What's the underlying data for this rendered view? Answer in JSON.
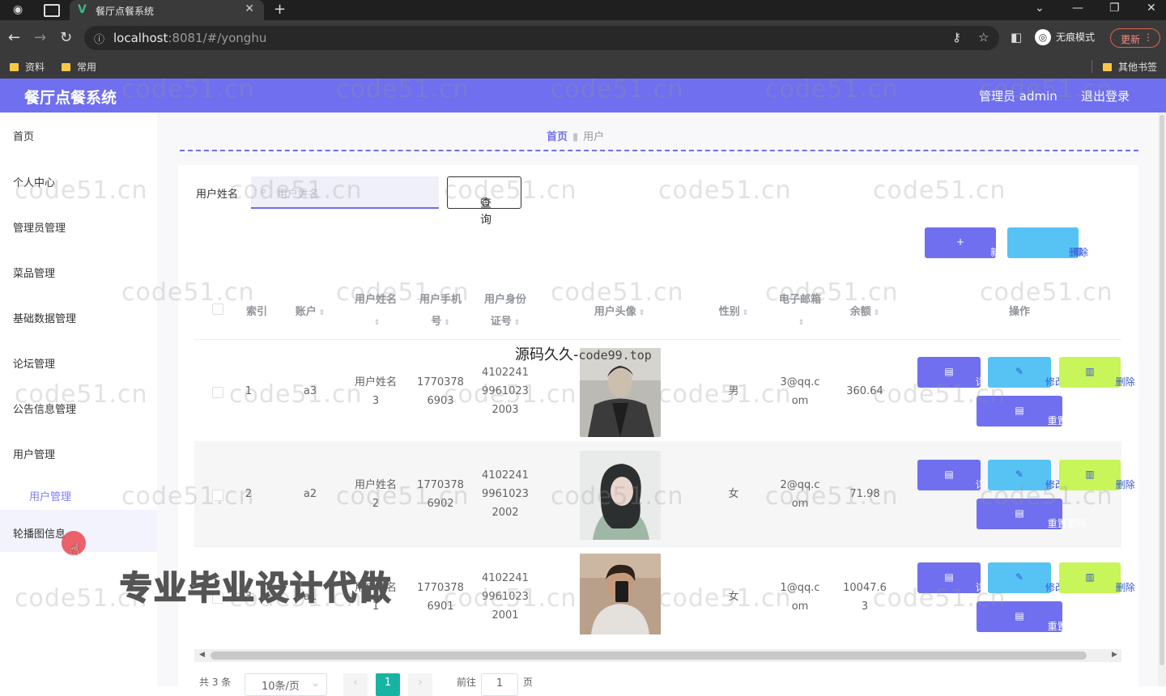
{
  "browser": {
    "tab_title": "餐厅点餐系统",
    "url_host": "localhost",
    "url_rest": ":8081/#/yonghu",
    "incognito_label": "无痕模式",
    "update_label": "更新",
    "bookmarks": [
      "资料",
      "常用"
    ],
    "other_bookmarks": "其他书签"
  },
  "header": {
    "app_title": "餐厅点餐系统",
    "admin_label": "管理员 admin",
    "logout_label": "退出登录"
  },
  "sidebar": {
    "items": [
      "首页",
      "个人中心",
      "管理员管理",
      "菜品管理",
      "基础数据管理",
      "论坛管理",
      "公告信息管理",
      "用户管理"
    ],
    "sub_item": "用户管理",
    "last_item": "轮播图信息"
  },
  "breadcrumb": {
    "home": "首页",
    "current": "用户"
  },
  "search": {
    "label": "用户姓名",
    "placeholder": "用户姓名",
    "button": "查询"
  },
  "toolbar": {
    "add": "新增",
    "delete": "删除"
  },
  "table": {
    "headers": {
      "index": "索引",
      "account": "账户",
      "name_1": "用户姓",
      "name_2": "名",
      "phone_1": "用户手机",
      "phone_2": "号",
      "idcard_1": "用户身份",
      "idcard_2": "证号",
      "avatar": "用户头像",
      "gender": "性别",
      "email": "电子邮箱",
      "balance": "余额",
      "ops": "操作"
    },
    "rows": [
      {
        "index": "1",
        "account": "a3",
        "name_1": "用户姓名",
        "name_2": "3",
        "phone_1": "1770378",
        "phone_2": "6903",
        "id_1": "4102241",
        "id_2": "9961023",
        "id_3": "2003",
        "gender": "男",
        "email_1": "3@qq.c",
        "email_2": "om",
        "balance_1": "360.64",
        "balance_2": ""
      },
      {
        "index": "2",
        "account": "a2",
        "name_1": "用户姓名",
        "name_2": "2",
        "phone_1": "1770378",
        "phone_2": "6902",
        "id_1": "4102241",
        "id_2": "9961023",
        "id_3": "2002",
        "gender": "女",
        "email_1": "2@qq.c",
        "email_2": "om",
        "balance_1": "71.98",
        "balance_2": ""
      },
      {
        "index": "3",
        "account": "a1",
        "name_1": "用户姓名",
        "name_2": "1",
        "phone_1": "1770378",
        "phone_2": "6901",
        "id_1": "4102241",
        "id_2": "9961023",
        "id_3": "2001",
        "gender": "女",
        "email_1": "1@qq.c",
        "email_2": "om",
        "balance_1": "10047.6",
        "balance_2": "3"
      }
    ],
    "ops": {
      "detail": "详情",
      "edit": "修改",
      "delete": "删除",
      "reset_pwd": "重置密码"
    }
  },
  "pagination": {
    "total": "共 3 条",
    "page_size": "10条/页",
    "current": "1",
    "goto": "前往",
    "goto_value": "1",
    "page_unit": "页"
  },
  "overlays": {
    "watermark": "code51.cn",
    "promo": "专业毕业设计代做",
    "source_cn": "源码久久-",
    "source_url": "code99.top"
  },
  "colors": {
    "accent": "#6f6fef",
    "info": "#57c3f5",
    "lime": "#c8f55a",
    "page_active": "#17b3a3"
  }
}
